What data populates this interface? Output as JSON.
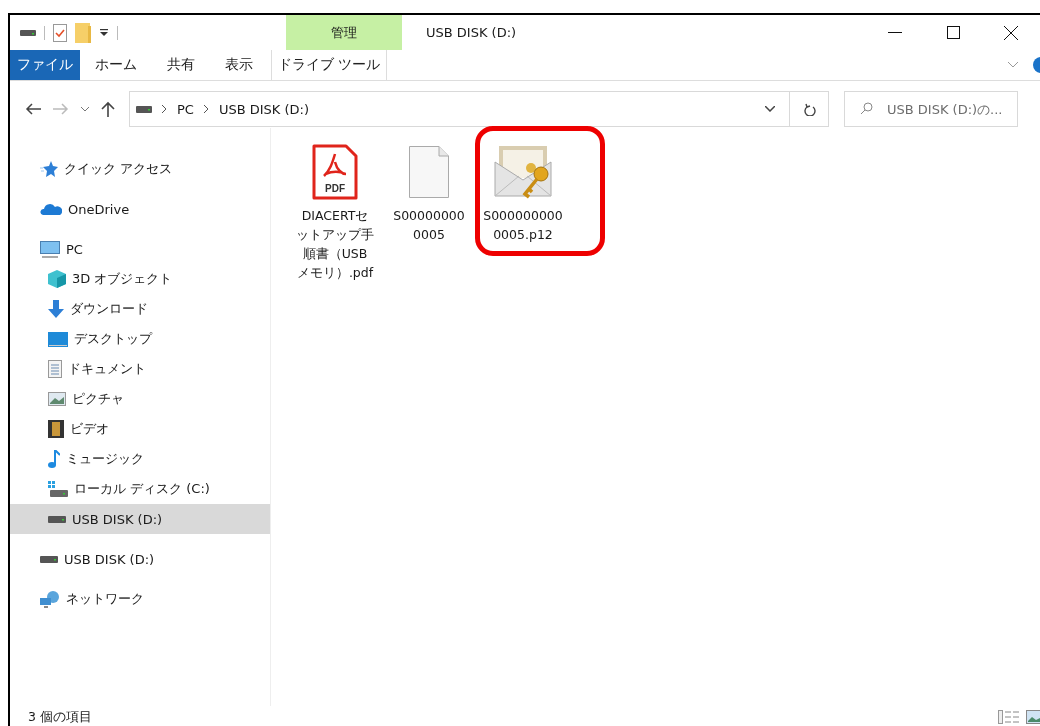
{
  "window": {
    "title": "USB DISK (D:)"
  },
  "ribbon": {
    "file_tab": "ファイル",
    "tabs": [
      {
        "label": "ホーム",
        "selected": false
      },
      {
        "label": "共有",
        "selected": false
      },
      {
        "label": "表示",
        "selected": false
      }
    ],
    "context_group": {
      "label": "管理",
      "tabs": [
        {
          "label": "ドライブ ツール",
          "selected": false
        }
      ]
    }
  },
  "address_bar": {
    "path": [
      "PC",
      "USB DISK (D:)"
    ]
  },
  "search": {
    "placeholder": "USB DISK (D:)の..."
  },
  "navigation": [
    {
      "label": "クイック アクセス",
      "selected": false
    },
    {
      "label": "OneDrive",
      "selected": false
    },
    {
      "label": "PC",
      "selected": false,
      "children": [
        {
          "label": "3D オブジェクト",
          "selected": false
        },
        {
          "label": "ダウンロード",
          "selected": false
        },
        {
          "label": "デスクトップ",
          "selected": false
        },
        {
          "label": "ドキュメント",
          "selected": false
        },
        {
          "label": "ピクチャ",
          "selected": false
        },
        {
          "label": "ビデオ",
          "selected": false
        },
        {
          "label": "ミュージック",
          "selected": false
        },
        {
          "label": "ローカル ディスク (C:)",
          "selected": false
        },
        {
          "label": "USB DISK (D:)",
          "selected": true
        }
      ]
    },
    {
      "label": "USB DISK (D:)",
      "selected": false
    },
    {
      "label": "ネットワーク",
      "selected": false
    }
  ],
  "files": [
    {
      "kind": "pdf",
      "icon_label": "PDF",
      "name_lines": [
        "DIACERTセ",
        "ットアップ手",
        "順書（USB",
        "メモリ）.pdf"
      ],
      "highlighted": false
    },
    {
      "kind": "blank",
      "name_lines": [
        "S00000000",
        "0005"
      ],
      "highlighted": false
    },
    {
      "kind": "certificate",
      "name_lines": [
        "S000000000",
        "0005.p12"
      ],
      "highlighted": true
    }
  ],
  "status_bar": {
    "item_count": "3 個の項目"
  }
}
